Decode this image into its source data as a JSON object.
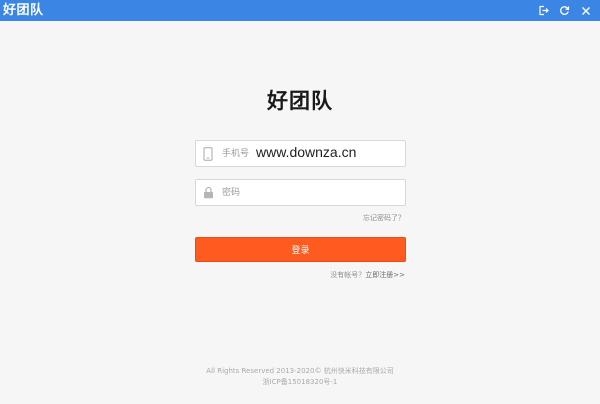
{
  "window": {
    "title": "好团队",
    "controls": [
      {
        "icon": "logout-icon"
      },
      {
        "icon": "refresh-icon"
      },
      {
        "icon": "close-icon"
      }
    ]
  },
  "brand": {
    "title": "好团队"
  },
  "form": {
    "phone_placeholder": "手机号",
    "phone_icon": "phone-icon",
    "password_placeholder": "密码",
    "password_icon": "lock-icon",
    "forgot_link": "忘记密码了？",
    "login_button": "登录",
    "register_prompt": "没有帐号？",
    "register_link": "立即注册>>"
  },
  "watermark": "www.downza.cn",
  "footer": {
    "copyright": "All Rights Reserved 2013-2020© 杭州快米科技有限公司",
    "icp": "浙ICP备15018320号-1"
  },
  "colors": {
    "titlebar": "#3b86e5",
    "accent": "#ff5a1f",
    "background": "#f6f6f6"
  }
}
